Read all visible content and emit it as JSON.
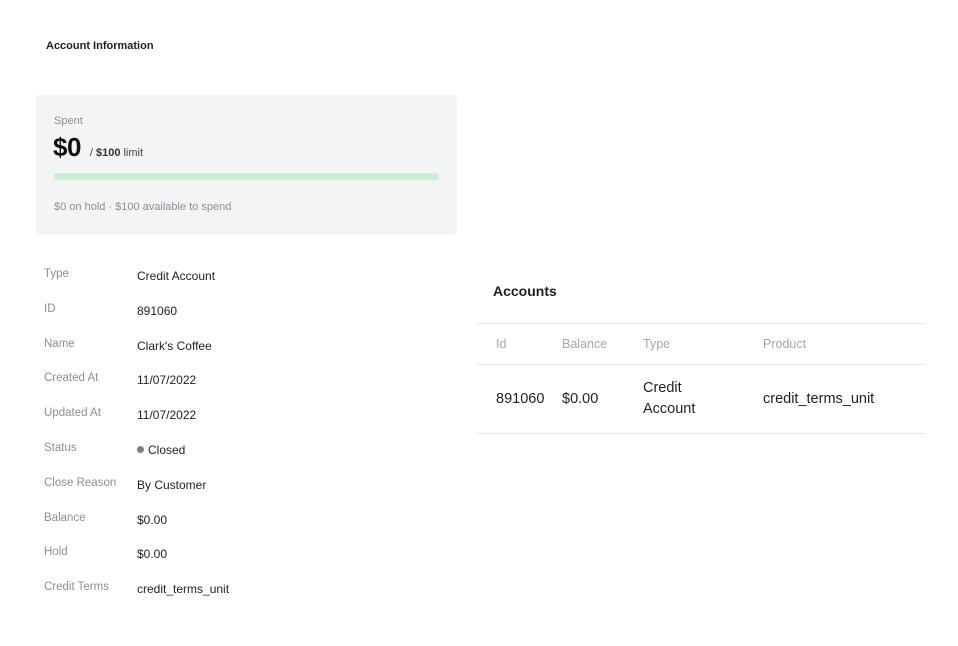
{
  "page": {
    "title": "Account Information"
  },
  "spend": {
    "label": "Spent",
    "amount": "$0",
    "separator": "/",
    "limit_amount": "$100",
    "limit_word": "limit",
    "progress_fraction": 0,
    "footer": "$0 on hold · $100 available to spend"
  },
  "details": [
    {
      "label": "Type",
      "value": "Credit Account"
    },
    {
      "label": "ID",
      "value": "891060"
    },
    {
      "label": "Name",
      "value": "Clark's Coffee"
    },
    {
      "label": "Created At",
      "value": "11/07/2022"
    },
    {
      "label": "Updated At",
      "value": "11/07/2022"
    },
    {
      "label": "Status",
      "value": "Closed"
    },
    {
      "label": "Close Reason",
      "value": "By Customer"
    },
    {
      "label": "Balance",
      "value": "$0.00"
    },
    {
      "label": "Hold",
      "value": "$0.00"
    },
    {
      "label": "Credit Terms",
      "value": "credit_terms_unit"
    }
  ],
  "accounts": {
    "title": "Accounts",
    "columns": [
      "Id",
      "Balance",
      "Type",
      "Product"
    ],
    "rows": [
      {
        "id": "891060",
        "balance": "$0.00",
        "type": "Credit Account",
        "product": "credit_terms_unit"
      }
    ]
  },
  "colors": {
    "card_background": "#f2f4f5",
    "progress_track": "#c8efd6",
    "progress_fill": "#2fbf71",
    "status_dot_closed": "#7d7d7d",
    "muted_text": "#8a8f94"
  },
  "icons": {
    "status": "status-dot-icon"
  }
}
